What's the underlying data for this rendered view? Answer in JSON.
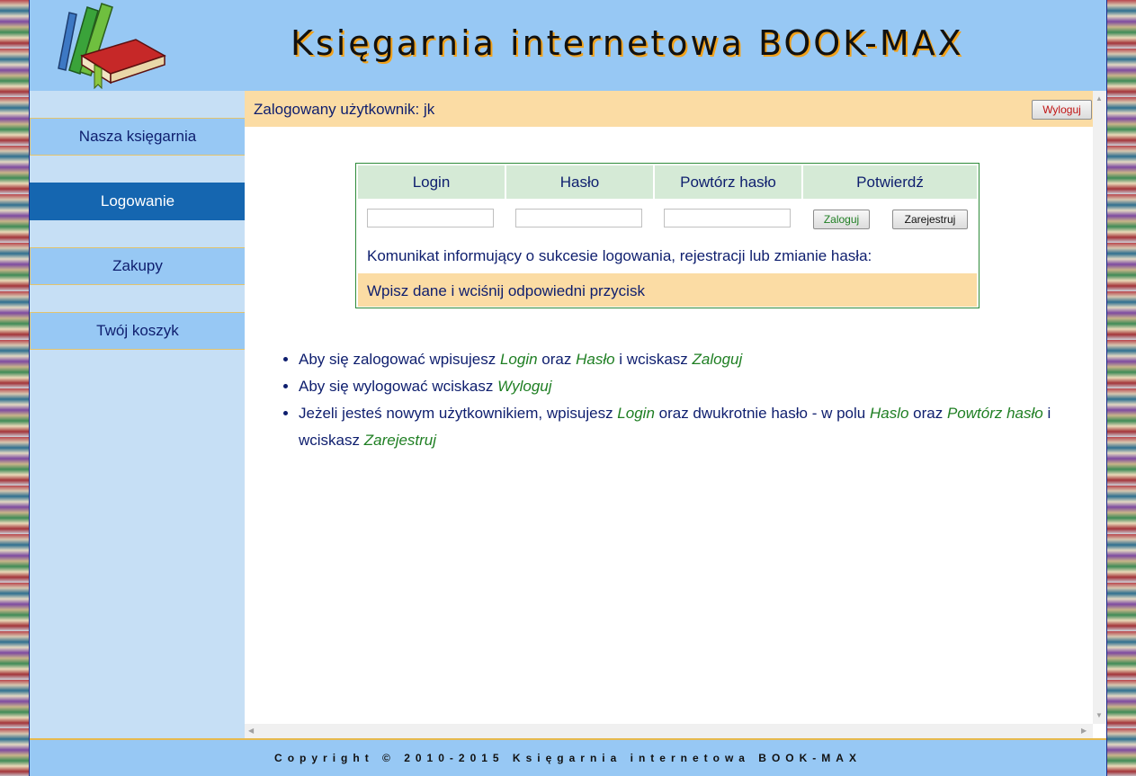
{
  "header": {
    "title": "Księgarnia internetowa BOOK-MAX",
    "logo": "books-logo"
  },
  "sidebar": {
    "items": [
      {
        "label": "Nasza księgarnia"
      },
      {
        "label": "Logowanie",
        "active": true
      },
      {
        "label": "Zakupy"
      },
      {
        "label": "Twój koszyk"
      }
    ]
  },
  "userbar": {
    "text": "Zalogowany użytkownik: jk",
    "logout_label": "Wyloguj"
  },
  "login_form": {
    "columns": [
      "Login",
      "Hasło",
      "Powtórz hasło",
      "Potwierdź"
    ],
    "login_value": "",
    "password_value": "",
    "repeat_value": "",
    "login_button": "Zaloguj",
    "register_button": "Zarejestruj",
    "message_label": "Komunikat informujący o sukcesie logowania, rejestracji lub zmianie hasła:",
    "message": "Wpisz dane i wciśnij odpowiedni przycisk"
  },
  "instructions": [
    {
      "parts": [
        {
          "t": "Aby się zalogować wpisujesz "
        },
        {
          "t": "Login",
          "hl": true
        },
        {
          "t": " oraz "
        },
        {
          "t": "Hasło",
          "hl": true
        },
        {
          "t": " i wciskasz "
        },
        {
          "t": "Zaloguj",
          "hl": true
        }
      ]
    },
    {
      "parts": [
        {
          "t": "Aby się wylogować wciskasz "
        },
        {
          "t": "Wyloguj",
          "hl": true
        }
      ]
    },
    {
      "parts": [
        {
          "t": "Jeżeli jesteś nowym użytkownikiem, wpisujesz "
        },
        {
          "t": "Login",
          "hl": true
        },
        {
          "t": " oraz dwukrotnie hasło - w polu "
        },
        {
          "t": "Haslo",
          "hl": true
        },
        {
          "t": " oraz "
        },
        {
          "t": "Powtórz hasło",
          "hl": true
        },
        {
          "t": " i wciskasz "
        },
        {
          "t": "Zarejestruj",
          "hl": true
        }
      ]
    }
  ],
  "footer": {
    "text": "Copyright © 2010-2015 Księgarnia internetowa BOOK-MAX"
  },
  "colors": {
    "header_bg": "#97c8f4",
    "sidebar_bg": "#c6dff5",
    "active_menu": "#1566b0",
    "highlight_bar": "#fbdca4",
    "link_green": "#1f7f23",
    "text_navy": "#0e1e6e"
  }
}
